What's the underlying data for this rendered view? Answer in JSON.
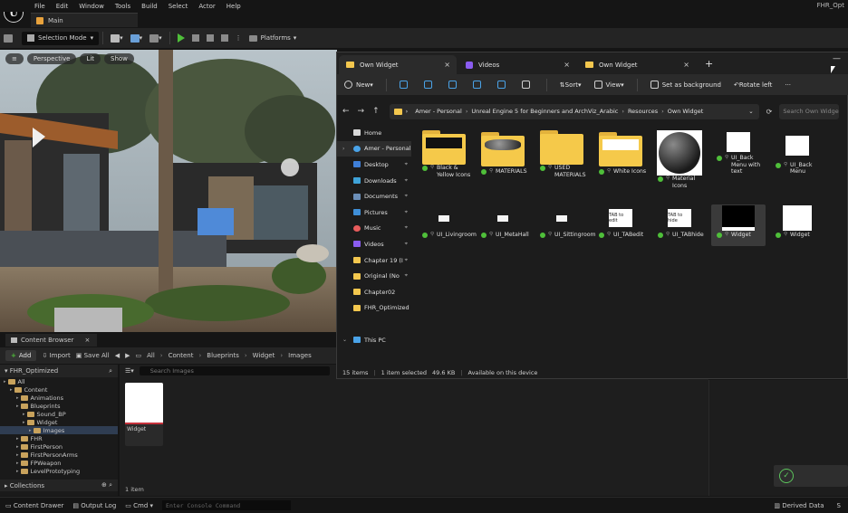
{
  "ue": {
    "menu": [
      "File",
      "Edit",
      "Window",
      "Tools",
      "Build",
      "Select",
      "Actor",
      "Help"
    ],
    "right_title": "FHR_Opt",
    "tab_main": "Main",
    "toolbar": {
      "selection_mode": "Selection Mode",
      "platforms": "Platforms"
    },
    "viewport": {
      "perspective": "Perspective",
      "lit": "Lit",
      "show": "Show"
    }
  },
  "content_browser": {
    "tab": "Content Browser",
    "add": "Add",
    "import": "Import",
    "save_all": "Save All",
    "breadcrumbs": [
      "All",
      "Content",
      "Blueprints",
      "Widget",
      "Images"
    ],
    "project": "FHR_Optimized",
    "search_placeholder": "Search Images",
    "tree": [
      {
        "label": "All",
        "depth": 0,
        "sel": false
      },
      {
        "label": "Content",
        "depth": 1,
        "sel": false
      },
      {
        "label": "Animations",
        "depth": 2,
        "sel": false
      },
      {
        "label": "Blueprints",
        "depth": 2,
        "sel": false
      },
      {
        "label": "Sound_BP",
        "depth": 3,
        "sel": false
      },
      {
        "label": "Widget",
        "depth": 3,
        "sel": false
      },
      {
        "label": "Images",
        "depth": 4,
        "sel": true
      },
      {
        "label": "FHR",
        "depth": 2,
        "sel": false
      },
      {
        "label": "FirstPerson",
        "depth": 2,
        "sel": false
      },
      {
        "label": "FirstPersonArms",
        "depth": 2,
        "sel": false
      },
      {
        "label": "FPWeapon",
        "depth": 2,
        "sel": false
      },
      {
        "label": "LevelPrototyping",
        "depth": 2,
        "sel": false
      }
    ],
    "asset_label": "Widget",
    "item_count": "1 item",
    "collections": "Collections"
  },
  "statusbar": {
    "content_drawer": "Content Drawer",
    "output_log": "Output Log",
    "cmd": "Cmd",
    "console_placeholder": "Enter Console Command",
    "derived_data": "Derived Data",
    "extra": "S"
  },
  "explorer": {
    "tabs": [
      {
        "label": "Own Widget",
        "kind": "folder",
        "active": true
      },
      {
        "label": "Videos",
        "kind": "video",
        "active": false
      },
      {
        "label": "Own Widget",
        "kind": "folder",
        "active": false
      }
    ],
    "commands": {
      "new": "New",
      "sort": "Sort",
      "view": "View",
      "set_bg": "Set as background",
      "rotate": "Rotate left",
      "more": "···"
    },
    "address": [
      "Amer - Personal",
      "Unreal Engine 5 for Beginners and ArchViz_Arabic",
      "Resources",
      "Own Widget"
    ],
    "search_placeholder": "Search Own Widget",
    "nav": [
      {
        "label": "Home",
        "icon": "home",
        "pin": false
      },
      {
        "label": "Amer - Personal",
        "icon": "cloud",
        "pin": false,
        "sel": true
      },
      {
        "label": "Desktop",
        "icon": "desktop",
        "pin": true
      },
      {
        "label": "Downloads",
        "icon": "downloads",
        "pin": true
      },
      {
        "label": "Documents",
        "icon": "documents",
        "pin": true
      },
      {
        "label": "Pictures",
        "icon": "pictures",
        "pin": true
      },
      {
        "label": "Music",
        "icon": "music",
        "pin": true
      },
      {
        "label": "Videos",
        "icon": "videos",
        "pin": true
      },
      {
        "label": "Chapter 19 (I",
        "icon": "folder",
        "pin": true
      },
      {
        "label": "Original (No",
        "icon": "folder",
        "pin": true
      },
      {
        "label": "Chapter02",
        "icon": "folder",
        "pin": false
      },
      {
        "label": "FHR_Optimized",
        "icon": "folder",
        "pin": false
      },
      {
        "label": "",
        "icon": "",
        "pin": false
      },
      {
        "label": "This PC",
        "icon": "pc",
        "pin": false
      }
    ],
    "files_row1": [
      {
        "label": "Black & Yellow Icons",
        "kind": "folder-dark"
      },
      {
        "label": "MATERIALS",
        "kind": "folder-sphere"
      },
      {
        "label": "USED MATERIALS",
        "kind": "folder"
      },
      {
        "label": "White Icons",
        "kind": "folder-white"
      },
      {
        "label": "Material Icons",
        "kind": "sphere"
      },
      {
        "label": "UI_Back Menu with text",
        "kind": "img-small"
      },
      {
        "label": "UI_Back Menu",
        "kind": "img-white"
      }
    ],
    "files_row2": [
      {
        "label": "UI_Livingroom",
        "kind": "img-tiny"
      },
      {
        "label": "UI_MetaHall",
        "kind": "img-tiny"
      },
      {
        "label": "UI_Sittingroom",
        "kind": "img-tiny"
      },
      {
        "label": "UI_TABedit",
        "kind": "img-tab",
        "thumb_text": "TAB to edit"
      },
      {
        "label": "UI_TABhide",
        "kind": "img-tab",
        "thumb_text": "TAB to hide"
      },
      {
        "label": "Widget",
        "kind": "img-black",
        "sel": true
      },
      {
        "label": "Widget",
        "kind": "img-white2"
      }
    ],
    "status": {
      "count": "15 items",
      "selected": "1 item selected",
      "size": "49.6 KB",
      "availability": "Available on this device"
    }
  }
}
